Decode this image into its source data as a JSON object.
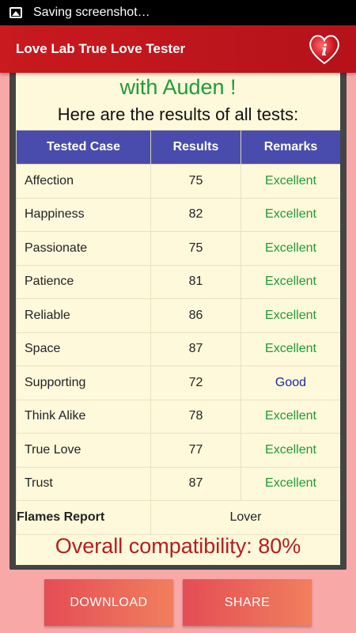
{
  "status_bar": {
    "notification_icon": "image-icon",
    "text": "Saving screenshot…"
  },
  "app_bar": {
    "title": "Love Lab True Love Tester",
    "info_icon": "heart-info-icon"
  },
  "results": {
    "partial_heading": "with Auden !",
    "subheading": "Here are the results of all tests:",
    "columns": [
      "Tested Case",
      "Results",
      "Remarks"
    ],
    "rows": [
      {
        "case": "Affection",
        "result": "75",
        "remark": "Excellent",
        "remark_color": "#1e9b34"
      },
      {
        "case": "Happiness",
        "result": "82",
        "remark": "Excellent",
        "remark_color": "#1e9b34"
      },
      {
        "case": "Passionate",
        "result": "75",
        "remark": "Excellent",
        "remark_color": "#1e9b34"
      },
      {
        "case": "Patience",
        "result": "81",
        "remark": "Excellent",
        "remark_color": "#1e9b34"
      },
      {
        "case": "Reliable",
        "result": "86",
        "remark": "Excellent",
        "remark_color": "#1e9b34"
      },
      {
        "case": "Space",
        "result": "87",
        "remark": "Excellent",
        "remark_color": "#1e9b34"
      },
      {
        "case": "Supporting",
        "result": "72",
        "remark": "Good",
        "remark_color": "#1a2b9a"
      },
      {
        "case": "Think Alike",
        "result": "78",
        "remark": "Excellent",
        "remark_color": "#1e9b34"
      },
      {
        "case": "True Love",
        "result": "77",
        "remark": "Excellent",
        "remark_color": "#1e9b34"
      },
      {
        "case": "Trust",
        "result": "87",
        "remark": "Excellent",
        "remark_color": "#1e9b34"
      }
    ],
    "flames_label": "Flames Report",
    "flames_value": "Lover",
    "overall": "Overall compatibility: 80%"
  },
  "buttons": {
    "download": "DOWNLOAD",
    "share": "SHARE"
  },
  "colors": {
    "app_bar": "#c81a1f",
    "header_row": "#4a4cad",
    "card_bg": "#fff9dc",
    "page_bg": "#f9a8a8",
    "overall_text": "#b71c1c"
  }
}
